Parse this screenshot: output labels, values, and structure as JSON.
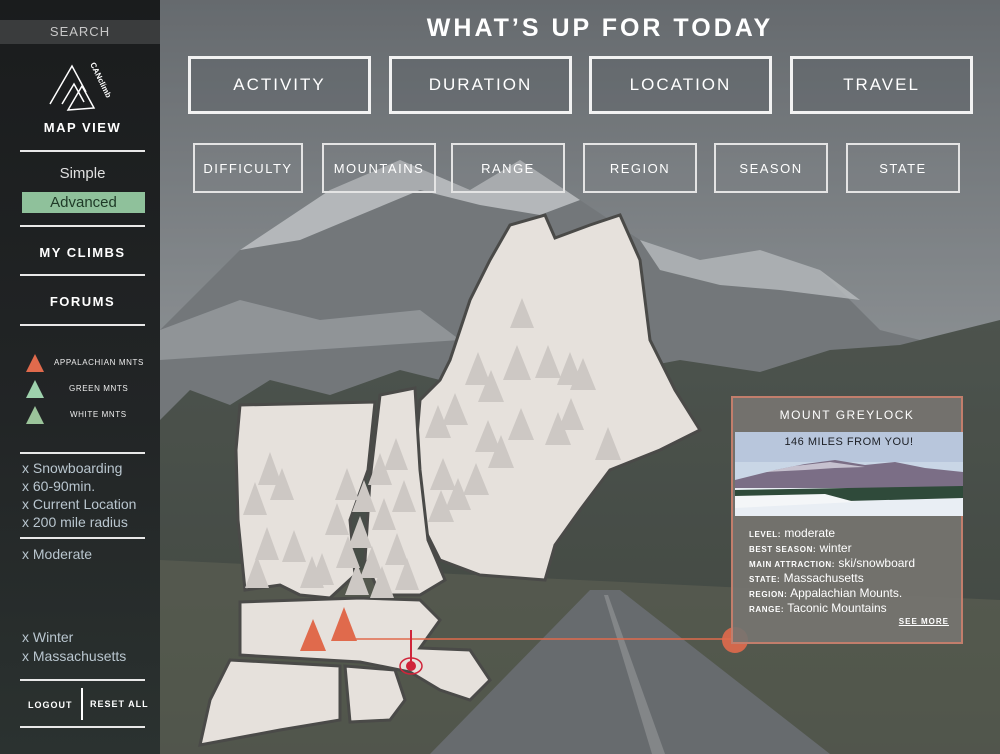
{
  "sidebar": {
    "search_label": "SEARCH",
    "logo_text": "CANclimb",
    "map_view": "MAP VIEW",
    "mode_simple": "Simple",
    "mode_advanced": "Advanced",
    "my_climbs": "MY CLIMBS",
    "forums": "FORUMS",
    "legend": [
      {
        "label": "APPALACHIAN MNTS",
        "color": "#e06a4c"
      },
      {
        "label": "GREEN MNTS",
        "color": "#9ed1ad"
      },
      {
        "label": "WHITE MNTS",
        "color": "#9bc49a"
      }
    ],
    "filters_group1": [
      "x Snowboarding",
      "x 60-90min.",
      "x Current Location",
      "x 200 mile radius"
    ],
    "filters_group2": [
      "x Moderate"
    ],
    "filters_group3": [
      "x Winter",
      "x Massachusetts"
    ],
    "logout": "LOGOUT",
    "reset_all": "RESET ALL"
  },
  "header": {
    "title": "WHAT’S UP FOR TODAY"
  },
  "primary_filters": [
    "ACTIVITY",
    "DURATION",
    "LOCATION",
    "TRAVEL"
  ],
  "secondary_filters": [
    "DIFFICULTY",
    "MOUNTAINS",
    "RANGE",
    "REGION",
    "SEASON",
    "STATE"
  ],
  "map": {
    "marker_color": "#e06a4c",
    "state_fill": "#e6e1dc"
  },
  "card": {
    "title": "MOUNT GREYLOCK",
    "distance": "146 MILES FROM YOU!",
    "rows": [
      {
        "key": "LEVEL:",
        "value": "moderate"
      },
      {
        "key": "BEST SEASON:",
        "value": "winter"
      },
      {
        "key": "MAIN ATTRACTION:",
        "value": "ski/snowboard"
      },
      {
        "key": "STATE:",
        "value": "Massachusetts"
      },
      {
        "key": "REGION:",
        "value": "Appalachian Mounts."
      },
      {
        "key": "RANGE:",
        "value": "Taconic Mountains"
      }
    ],
    "see_more": "SEE MORE"
  }
}
